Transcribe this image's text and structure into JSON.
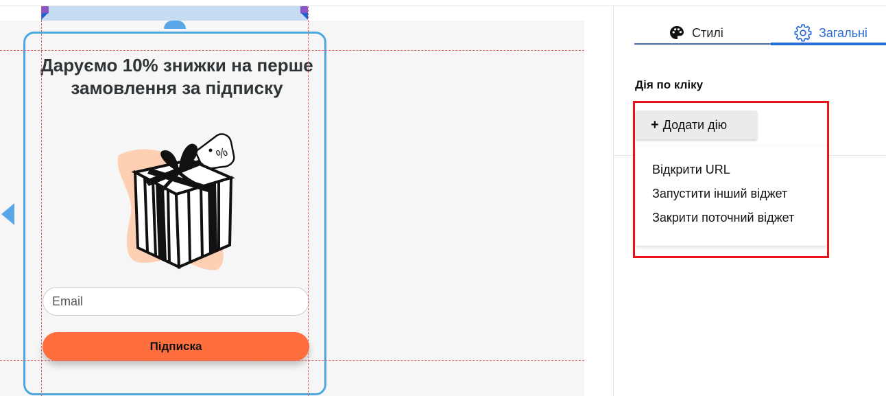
{
  "widget": {
    "headline": "Даруємо 10% знижки на перше замовлення за підписку",
    "email_placeholder": "Email",
    "subscribe_label": "Підписка",
    "gift_tag_text": "%"
  },
  "panel": {
    "tabs": [
      {
        "label": "Стилі",
        "icon": "palette-icon"
      },
      {
        "label": "Загальні",
        "icon": "gear-icon",
        "active": true
      }
    ],
    "section_label": "Дія по кліку",
    "add_action_label": "Додати дію",
    "add_action_icon": "plus-icon",
    "menu_items": [
      "Відкрити URL",
      "Запустити інший віджет",
      "Закрити поточний віджет"
    ]
  },
  "colors": {
    "accent_blue": "#2b6bd6",
    "selection_border": "#4aa7e0",
    "subscribe_button": "#ff6f3d",
    "highlight_frame": "#e8141c"
  }
}
